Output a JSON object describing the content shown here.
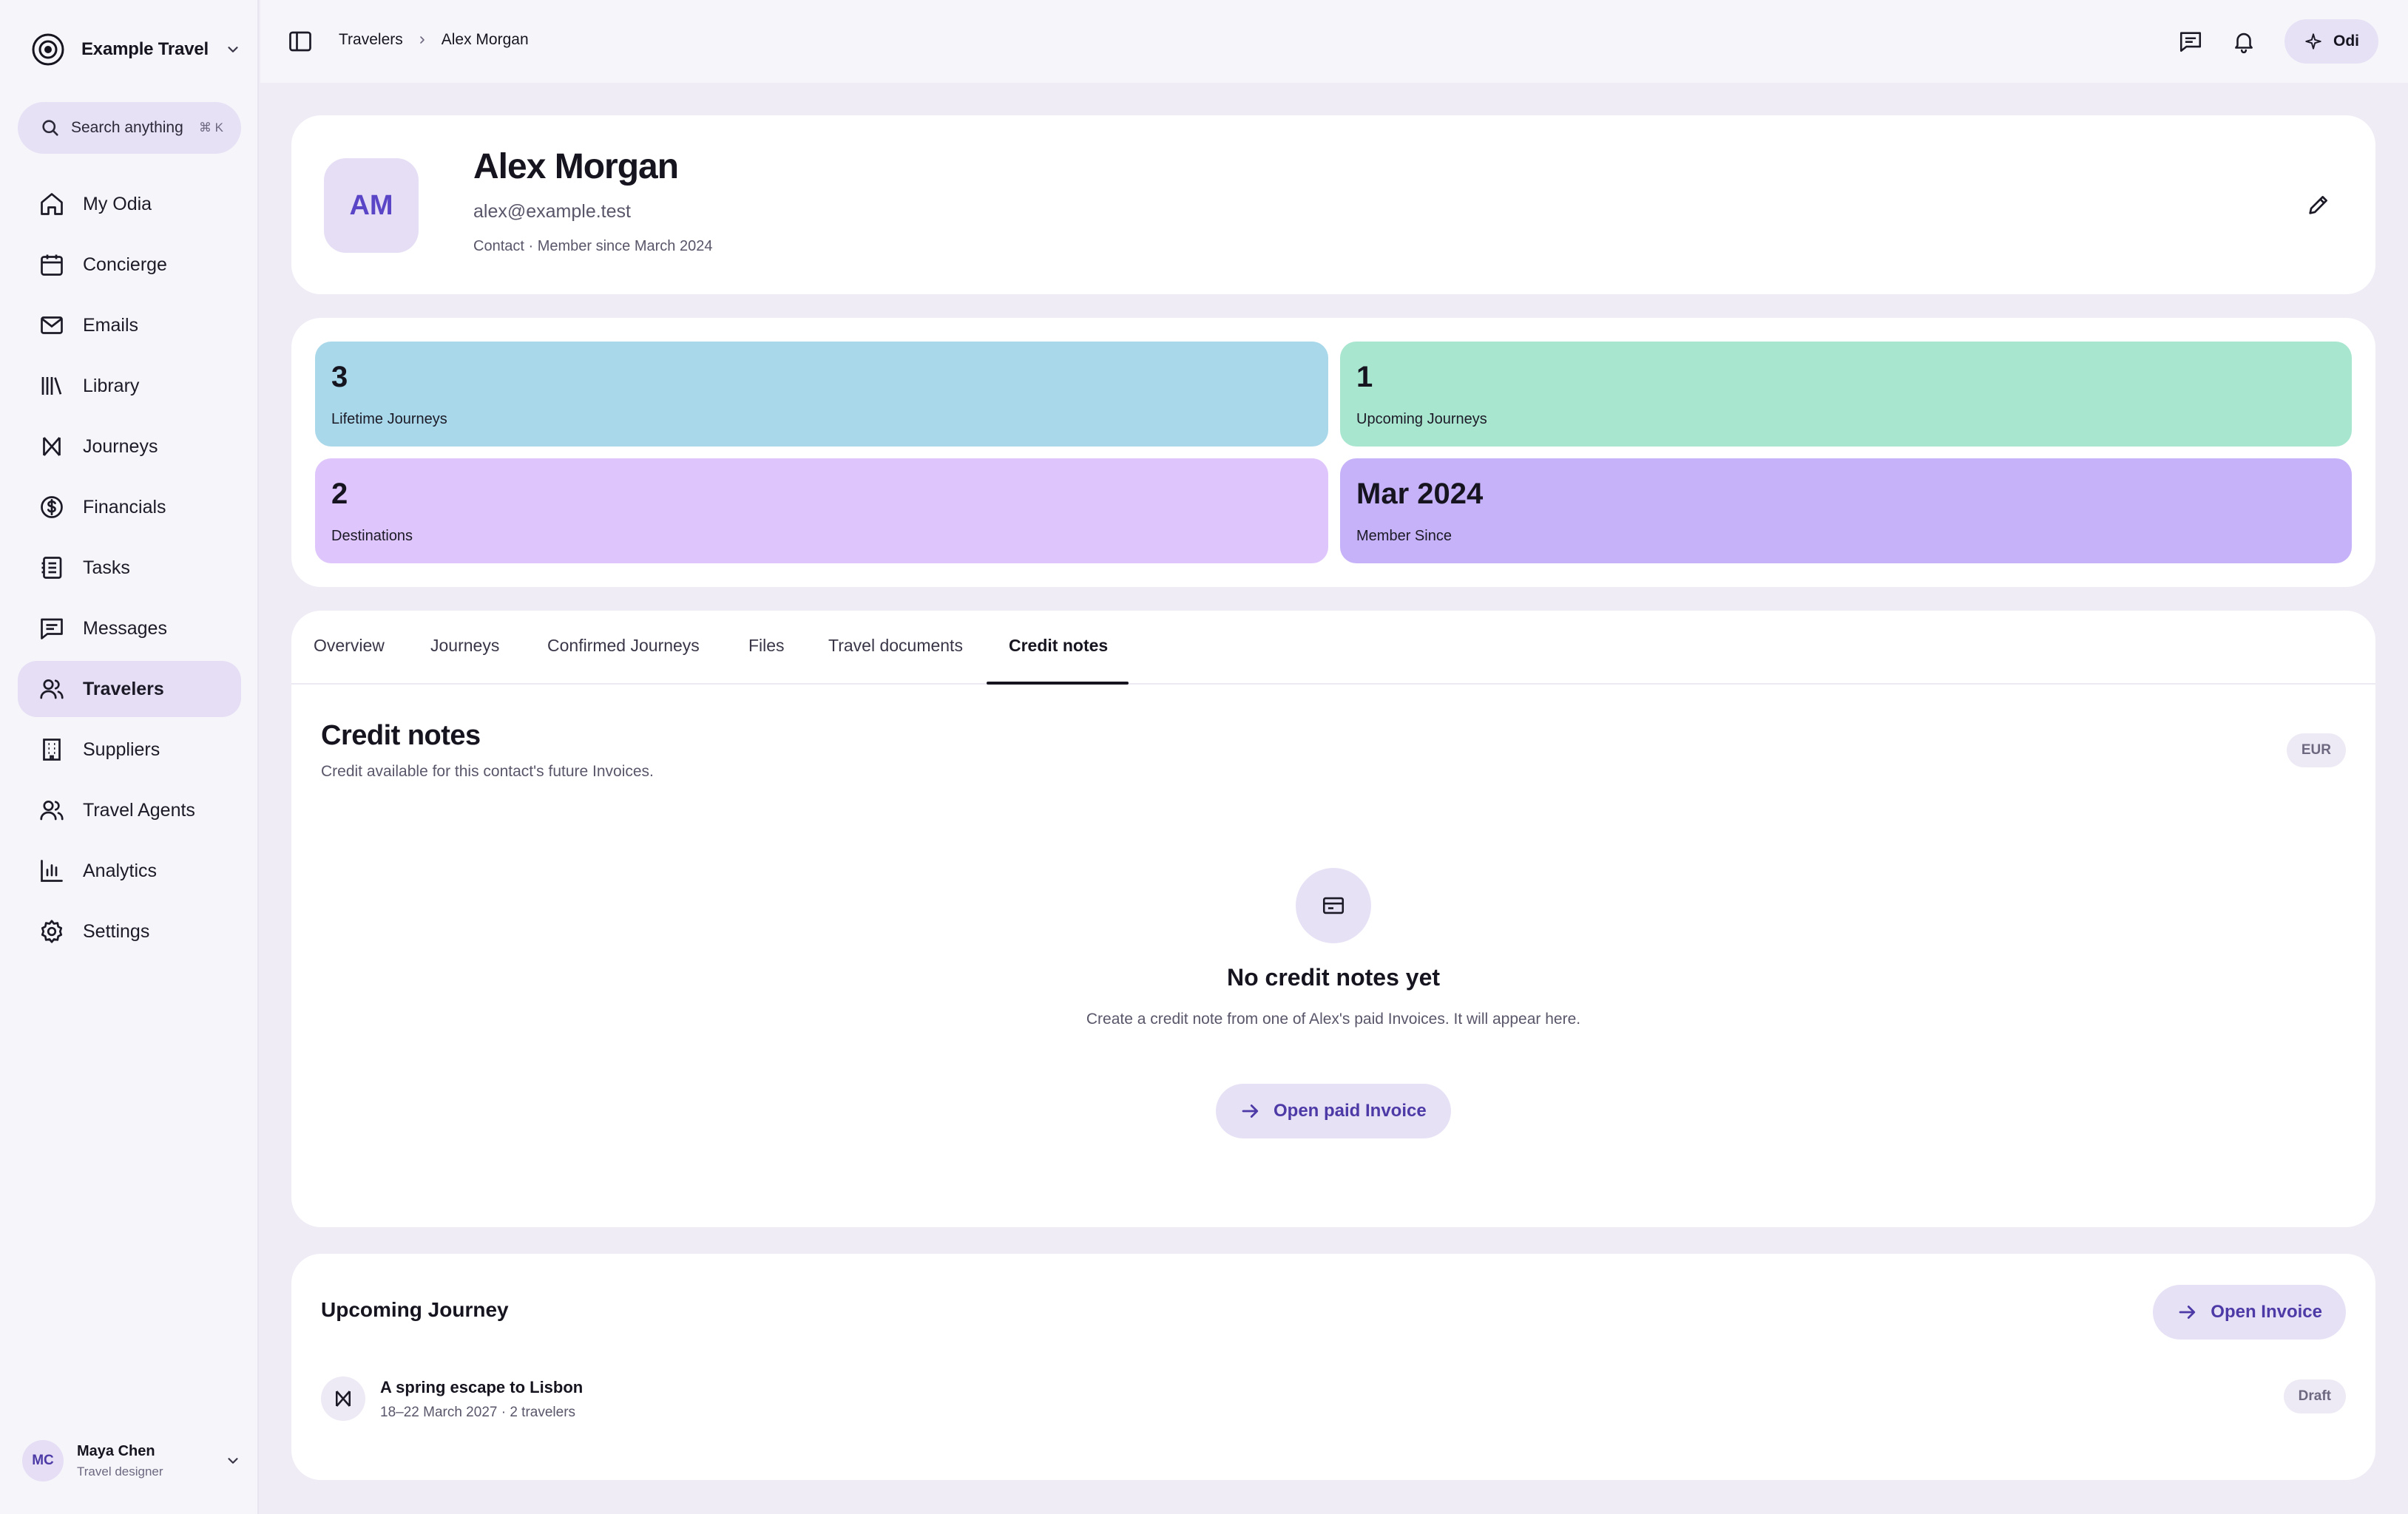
{
  "org": {
    "name": "Example Travel",
    "logo_icon": "target-logo-icon",
    "switch_icon": "chevron-down-icon"
  },
  "search": {
    "placeholder": "Search anything",
    "shortcut": "⌘ K",
    "icon": "search-icon"
  },
  "sidebar": {
    "items": [
      {
        "label": "My Odia",
        "icon": "home-icon",
        "active": false
      },
      {
        "label": "Concierge",
        "icon": "calendar-icon",
        "active": false
      },
      {
        "label": "Emails",
        "icon": "mail-icon",
        "active": false
      },
      {
        "label": "Library",
        "icon": "library-icon",
        "active": false
      },
      {
        "label": "Journeys",
        "icon": "journeys-icon",
        "active": false
      },
      {
        "label": "Financials",
        "icon": "dollar-icon",
        "active": false
      },
      {
        "label": "Tasks",
        "icon": "tasks-icon",
        "active": false
      },
      {
        "label": "Messages",
        "icon": "message-icon",
        "active": false
      },
      {
        "label": "Travelers",
        "icon": "users-icon",
        "active": true
      },
      {
        "label": "Suppliers",
        "icon": "building-icon",
        "active": false
      },
      {
        "label": "Travel Agents",
        "icon": "agents-icon",
        "active": false
      },
      {
        "label": "Analytics",
        "icon": "chart-icon",
        "active": false
      },
      {
        "label": "Settings",
        "icon": "gear-icon",
        "active": false
      }
    ]
  },
  "user": {
    "initials": "MC",
    "name": "Maya Chen",
    "role": "Travel designer"
  },
  "topbar": {
    "breadcrumb": [
      "Travelers",
      "Alex Morgan"
    ],
    "assistant_label": "Odi"
  },
  "profile": {
    "initials": "AM",
    "name": "Alex Morgan",
    "email": "alex@example.test",
    "meta": "Contact · Member since March 2024"
  },
  "stats": [
    {
      "value": "3",
      "label": "Lifetime Journeys",
      "color": "#a8d8ea"
    },
    {
      "value": "1",
      "label": "Upcoming Journeys",
      "color": "#a9e6d0"
    },
    {
      "value": "2",
      "label": "Destinations",
      "color": "#dec5fb"
    },
    {
      "value": "Mar 2024",
      "label": "Member Since",
      "color": "#c6b2f8"
    }
  ],
  "tabs": [
    {
      "label": "Overview",
      "active": false
    },
    {
      "label": "Journeys",
      "active": false
    },
    {
      "label": "Confirmed Journeys",
      "active": false
    },
    {
      "label": "Files",
      "active": false
    },
    {
      "label": "Travel documents",
      "active": false
    },
    {
      "label": "Credit notes",
      "active": true
    }
  ],
  "credit_notes": {
    "title": "Credit notes",
    "subtitle": "Credit available for this contact's future Invoices.",
    "currency": "EUR",
    "empty_title": "No credit notes yet",
    "empty_desc": "Create a credit note from one of Alex's paid Invoices. It will appear here.",
    "action_label": "Open paid Invoice"
  },
  "upcoming": {
    "title": "Upcoming Journey",
    "action_label": "Open Invoice",
    "trip_name": "A spring escape to Lisbon",
    "trip_meta": "18–22 March 2027 · 2 travelers",
    "status": "Draft"
  },
  "colors": {
    "accent": "#4d3aa6",
    "pill_bg": "#e7e1f6",
    "active_nav": "#e5def5"
  }
}
